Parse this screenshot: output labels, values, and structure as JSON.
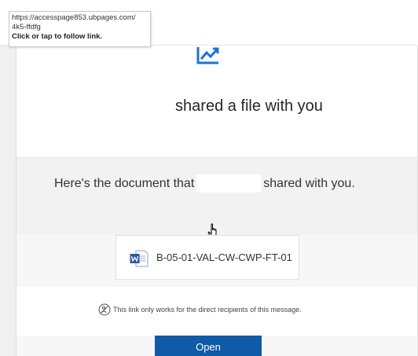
{
  "tooltip": {
    "url_line1": "https://accesspage853.ubpages.com/",
    "url_line2": "4k5-ffdfg",
    "hint": "Click or tap to follow link."
  },
  "header": {
    "logo_icon": "chart-line-icon",
    "title": "shared a file with you"
  },
  "message": {
    "prefix": "Here's the document that",
    "suffix": "shared with you."
  },
  "file": {
    "icon": "word-document-icon",
    "name": "B-05-01-VAL-CW-CWP-FT-01"
  },
  "notice": {
    "icon": "restricted-link-icon",
    "text": "This link only works for the direct recipients of this message."
  },
  "actions": {
    "open_label": "Open"
  },
  "colors": {
    "accent": "#0f5ba7",
    "word_blue": "#2b579a",
    "logo_blue": "#1e73d6"
  }
}
